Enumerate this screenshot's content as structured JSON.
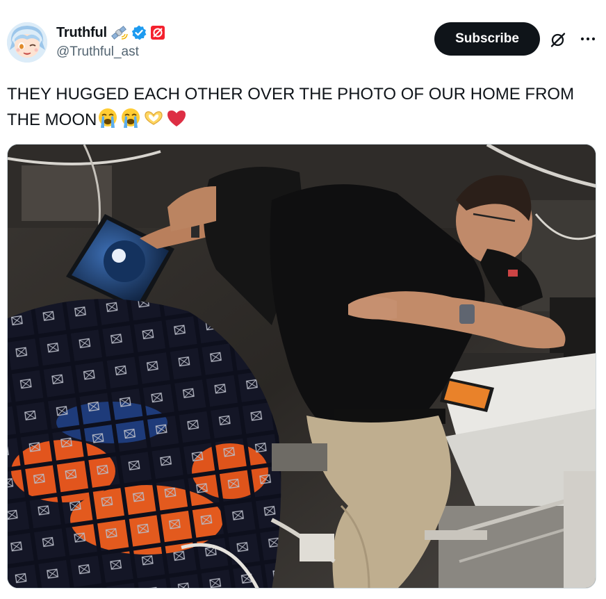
{
  "author": {
    "display_name": "Truthful",
    "handle": "@Truthful_ast",
    "avatar_icon": "anime-avatar-icon",
    "badges": [
      "satellite-emoji-icon",
      "verified-badge-icon",
      "affiliate-badge-icon"
    ],
    "verified_color": "#1d9bf0",
    "affiliate_color": "#f4212e"
  },
  "actions": {
    "subscribe_label": "Subscribe",
    "grok_icon": "grok-icon",
    "more_icon": "more-options-icon"
  },
  "post": {
    "text": "THEY HUGGED EACH OTHER OVER THE PHOTO OF OUR HOME FROM THE MOON",
    "emojis": [
      "loudly-crying-face-emoji",
      "loudly-crying-face-emoji",
      "heart-hands-emoji",
      "red-heart-emoji"
    ]
  },
  "media": {
    "type": "video-still",
    "subject": "astronauts-hugging-photo"
  },
  "colors": {
    "text": "#0f1419",
    "secondary_text": "#536471",
    "button_bg": "#0f1419",
    "button_text": "#ffffff",
    "border": "#cfd9de"
  }
}
